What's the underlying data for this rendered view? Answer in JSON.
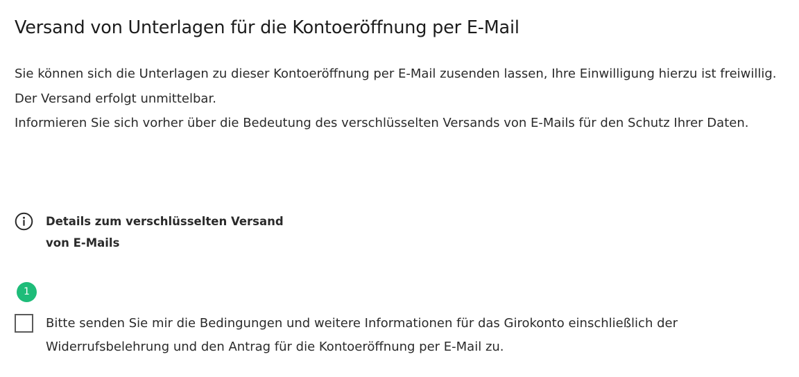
{
  "page": {
    "title": "Versand von Unterlagen für die Kontoeröffnung per E-Mail",
    "intro_line1": "Sie können sich die Unterlagen zu dieser Kontoeröffnung per E-Mail zusenden lassen, Ihre Einwilligung hierzu ist freiwillig. Der Versand erfolgt unmittelbar.",
    "intro_line2": "Informieren Sie sich vorher über die Bedeutung des verschlüsselten Versands von E-Mails für den Schutz Ihrer Daten."
  },
  "details": {
    "icon": "info-icon",
    "label": "Details zum verschlüsselten Versand von E-Mails"
  },
  "step": {
    "number": "1",
    "color": "#1ebc79"
  },
  "consent": {
    "checked": false,
    "label": "Bitte senden Sie mir die Bedingungen und weitere Informationen für das Girokonto einschließlich der Widerrufsbelehrung und den Antrag für die Kontoeröffnung per E-Mail zu."
  }
}
